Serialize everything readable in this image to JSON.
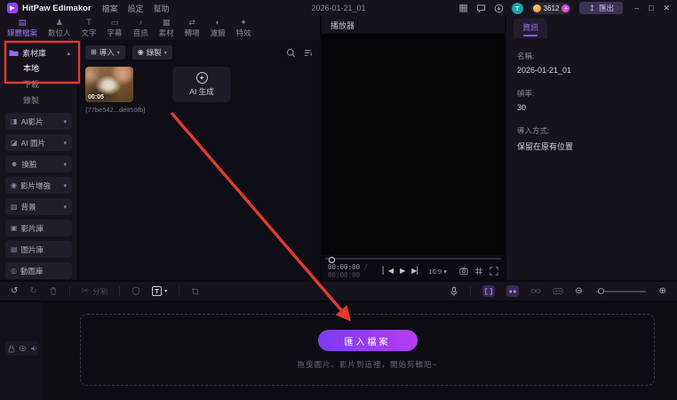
{
  "titlebar": {
    "app_name": "HitPaw Edimakor",
    "menus": [
      "檔案",
      "設定",
      "幫助"
    ],
    "project_name": "2026-01-21_01",
    "avatar_letter": "T",
    "coins": "3612",
    "plus": "+",
    "export_label": "匯出"
  },
  "tabs": [
    {
      "label": "媒體檔案",
      "icon": "▤",
      "active": true
    },
    {
      "label": "數位人",
      "icon": "♟"
    },
    {
      "label": "文字",
      "icon": "T"
    },
    {
      "label": "字幕",
      "icon": "▭"
    },
    {
      "label": "音訊",
      "icon": "♪"
    },
    {
      "label": "素材",
      "icon": "▦"
    },
    {
      "label": "轉場",
      "icon": "⇄"
    },
    {
      "label": "濾鏡",
      "icon": "◐"
    },
    {
      "label": "特效",
      "icon": "✦"
    }
  ],
  "sidebar": {
    "library_label": "素材庫",
    "tree": [
      {
        "label": "本地",
        "active": true
      },
      {
        "label": "下載"
      },
      {
        "label": "錄製"
      }
    ],
    "buttons": [
      {
        "label": "AI影片",
        "icon": "◨"
      },
      {
        "label": "AI 圖片",
        "icon": "◪"
      },
      {
        "label": "換臉",
        "icon": "☻"
      },
      {
        "label": "影片增強",
        "icon": "◉"
      },
      {
        "label": "背景",
        "icon": "▨"
      },
      {
        "label": "影片庫",
        "icon": "▣"
      },
      {
        "label": "圖片庫",
        "icon": "▤"
      },
      {
        "label": "動圖庫",
        "icon": "◎"
      }
    ]
  },
  "media": {
    "import_label": "導入",
    "record_label": "錄製",
    "clip_duration": "00:05",
    "clip_filename": "{77be542...de859fb}",
    "ai_generate_label": "AI 生成"
  },
  "player": {
    "title": "播放器",
    "time_current": "00:00:00",
    "time_total": " / 00:00:00",
    "aspect_ratio": "16:9"
  },
  "info": {
    "tab_label": "資訊",
    "fields": [
      {
        "label": "名稱:",
        "value": "2026-01-21_01"
      },
      {
        "label": "幀率:",
        "value": "30"
      },
      {
        "label": "導入方式:",
        "value": "保留在原有位置"
      }
    ]
  },
  "toolbar": {
    "split_label": "分割",
    "text_tool_label": "T"
  },
  "dropzone": {
    "button_label": "匯入檔案",
    "hint": "拖曳圖片、影片到這裡，開始剪輯吧~"
  },
  "icons": {
    "logo_play": "▶",
    "layout_board": "▦",
    "minimize": "–",
    "maximize": "□",
    "close": "✕",
    "caret_down": "▾",
    "caret_up": "▴",
    "export_up": "↥",
    "import_plus": "⊞",
    "record_dot": "◉",
    "sparkle": "✦",
    "undo": "↺",
    "redo": "↻",
    "scissors": "✂",
    "prev_frame": "▏◀",
    "play": "▶",
    "next_frame": "▶▏",
    "zoom_out": "⊖",
    "zoom_in": "⊕"
  },
  "colors": {
    "accent": "#9c63f2",
    "annotation_red": "#e23b30",
    "coin_orange": "#f0a33c",
    "avatar_teal": "#17a3ab",
    "import_button_gradient": [
      "#7e3bf2",
      "#b53ef2"
    ]
  }
}
